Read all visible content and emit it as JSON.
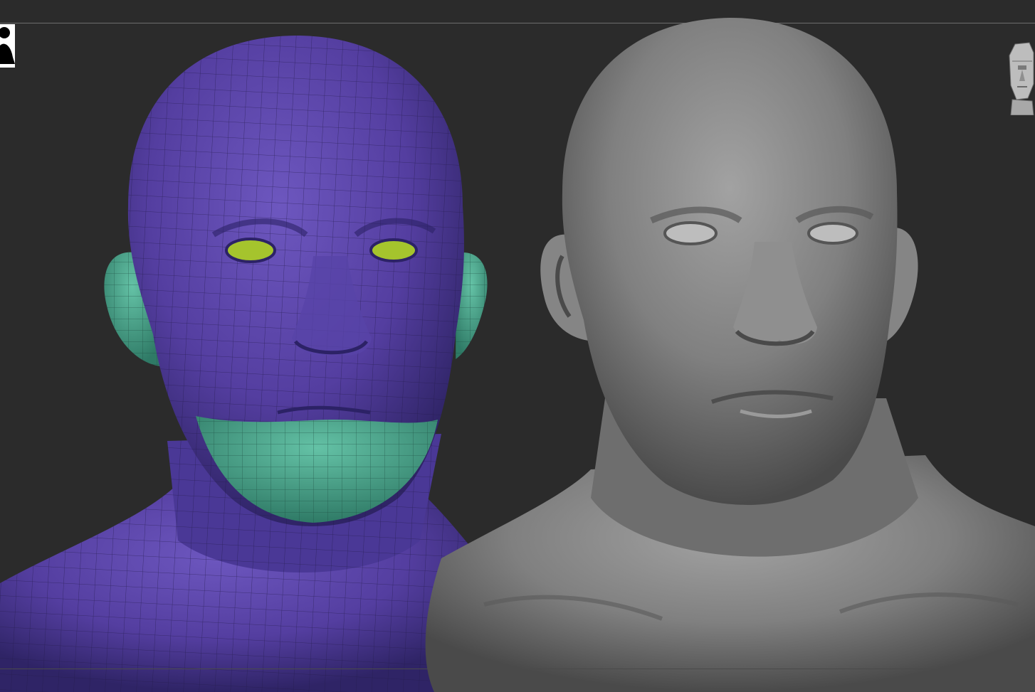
{
  "canvas": {
    "background": "#2b2b2b"
  },
  "models": {
    "polygroup_view": {
      "icon": "polygroup-head-mesh",
      "colors": {
        "skin": "#5a43a6",
        "groups": "#4fa88e",
        "eyes": "#9fbf2c",
        "wire": "#2b2256"
      }
    },
    "sculpt_view": {
      "icon": "sculpted-head-mesh",
      "colors": {
        "clay": "#7a7a7a"
      }
    }
  },
  "widgets": {
    "user_thumbnail": {
      "icon": "user-silhouette-icon"
    },
    "navigation": {
      "icon": "head-navigation-cube-icon"
    }
  }
}
